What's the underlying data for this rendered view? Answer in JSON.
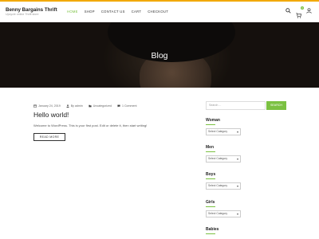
{
  "header": {
    "site_title": "Benny Bargains Thrift",
    "site_tagline": "Upcycle online Thrift store",
    "nav": [
      {
        "label": "HOME",
        "active": true
      },
      {
        "label": "SHOP",
        "active": false
      },
      {
        "label": "CONTACT US",
        "active": false
      },
      {
        "label": "CART",
        "active": false
      },
      {
        "label": "CHECKOUT",
        "active": false
      }
    ],
    "icons": [
      "search-icon",
      "cart-icon",
      "user-icon"
    ],
    "cart_count": "0"
  },
  "hero": {
    "title": "Blog"
  },
  "post": {
    "date": "January 24, 2019",
    "author": "By admin",
    "category": "Uncategorized",
    "comments": "1 Comment",
    "title": "Hello world!",
    "excerpt": "Welcome to WordPress. This is your first post. Edit or delete it, then start writing!",
    "read_more": "READ MORE"
  },
  "sidebar": {
    "search_placeholder": "Search ...",
    "search_button": "SEARCH",
    "widgets": [
      {
        "title": "Woman",
        "select": "Select Category"
      },
      {
        "title": "Men",
        "select": "Select Category"
      },
      {
        "title": "Boys",
        "select": "Select Category"
      },
      {
        "title": "Girls",
        "select": "Select Category"
      },
      {
        "title": "Babies"
      }
    ]
  },
  "colors": {
    "accent": "#7bc142",
    "top_bar": "#f2a900"
  }
}
